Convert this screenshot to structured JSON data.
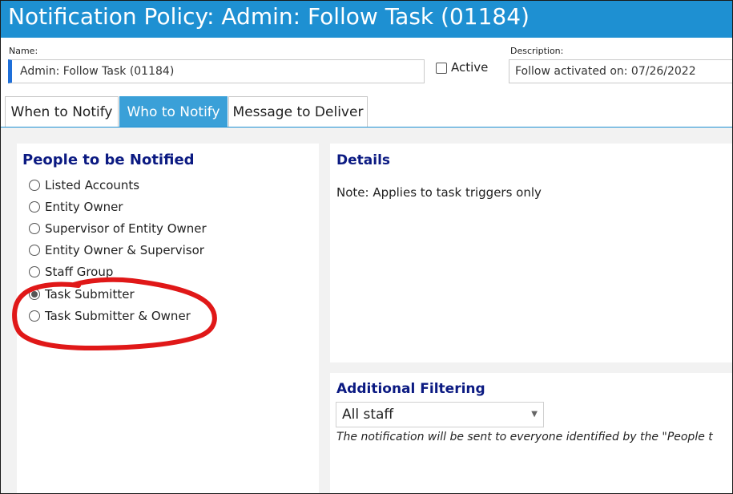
{
  "window": {
    "title": "Notification Policy: Admin: Follow Task (01184)"
  },
  "form": {
    "name_label": "Name:",
    "name_value": "Admin: Follow Task (01184)",
    "active_label": "Active",
    "active_checked": false,
    "description_label": "Description:",
    "description_value": "Follow activated on: 07/26/2022"
  },
  "tabs": [
    {
      "label": "When to Notify",
      "active": false
    },
    {
      "label": "Who to Notify",
      "active": true
    },
    {
      "label": "Message to Deliver",
      "active": false
    }
  ],
  "people_panel": {
    "title": "People to be Notified",
    "options": [
      {
        "label": "Listed Accounts",
        "selected": false
      },
      {
        "label": "Entity Owner",
        "selected": false
      },
      {
        "label": "Supervisor of Entity Owner",
        "selected": false
      },
      {
        "label": "Entity Owner & Supervisor",
        "selected": false
      },
      {
        "label": "Staff Group",
        "selected": false
      },
      {
        "label": "Task Submitter",
        "selected": true
      },
      {
        "label": "Task Submitter & Owner",
        "selected": false
      }
    ]
  },
  "details_panel": {
    "title": "Details",
    "note": "Note: Applies to task triggers only"
  },
  "filtering_panel": {
    "title": "Additional Filtering",
    "select_value": "All staff",
    "note": "The notification will be sent to everyone identified by the \"People t"
  },
  "colors": {
    "titlebar": "#1e90d2",
    "active_tab": "#3aa0d8",
    "heading": "#0b1a82",
    "annotation": "#e01818"
  }
}
